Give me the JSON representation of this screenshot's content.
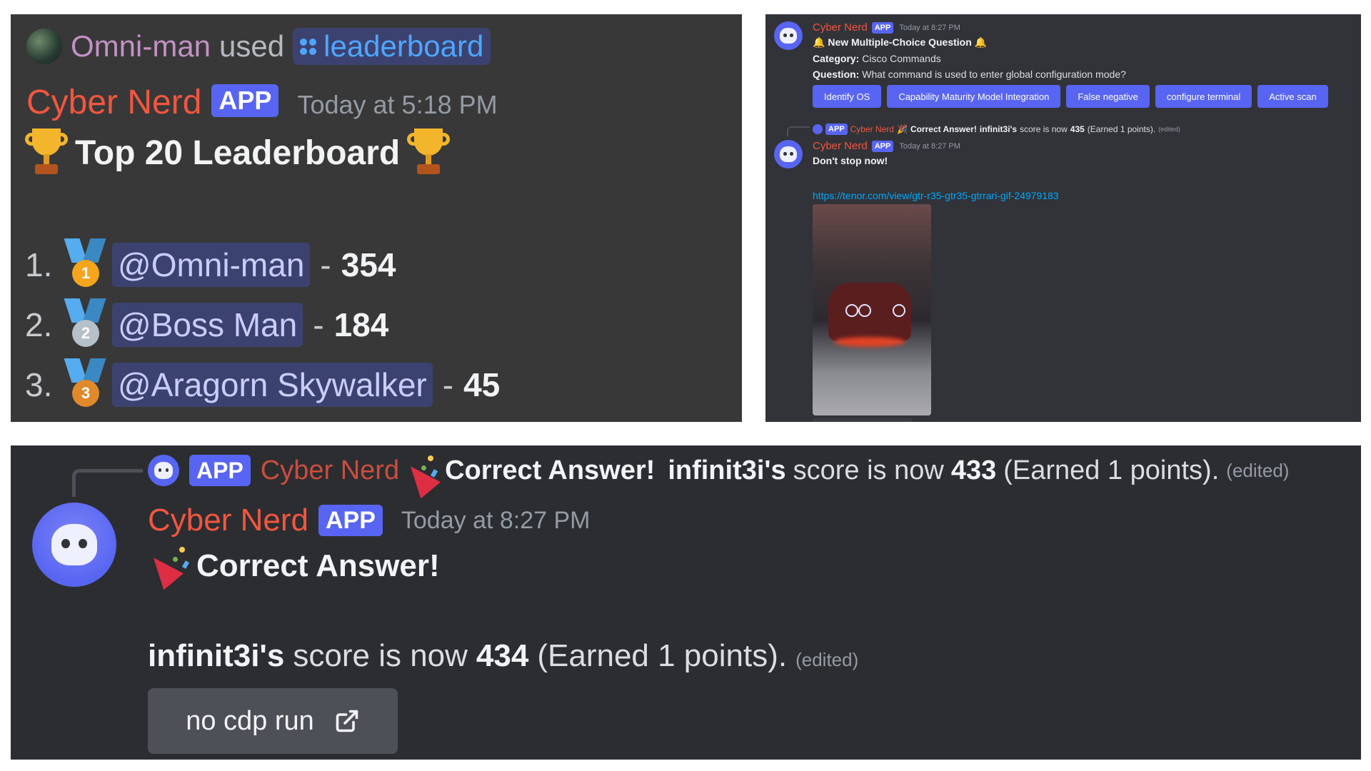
{
  "leaderboard_panel": {
    "invoker": "Omni-man",
    "used_text": "used",
    "command": "leaderboard",
    "bot_name": "Cyber Nerd",
    "app_tag": "APP",
    "timestamp": "Today at 5:18 PM",
    "title": "Top 20 Leaderboard",
    "entries": [
      {
        "rank": "1.",
        "medal": "1",
        "name": "@Omni-man",
        "score": "354",
        "medal_color": "#f4a51c"
      },
      {
        "rank": "2.",
        "medal": "2",
        "name": "@Boss Man",
        "score": "184",
        "medal_color": "#b6c0c9"
      },
      {
        "rank": "3.",
        "medal": "3",
        "name": "@Aragorn Skywalker",
        "score": "45",
        "medal_color": "#e08a2c"
      }
    ]
  },
  "question_panel": {
    "bot_name": "Cyber Nerd",
    "app_tag": "APP",
    "timestamp": "Today at 8:27 PM",
    "heading": "New Multiple-Choice Question",
    "category_label": "Category:",
    "category_value": "Cisco Commands",
    "question_label": "Question:",
    "question_value": "What command is used to enter global configuration mode?",
    "choices": [
      "Identify OS",
      "Capability Maturity Model Integration",
      "False negative",
      "configure terminal",
      "Active scan"
    ],
    "reply": {
      "bot_name": "Cyber Nerd",
      "heading": "Correct Answer!",
      "user": "infinit3i's",
      "text": "score is now",
      "score": "435",
      "earned": "(Earned 1 points).",
      "edited": "(edited)"
    },
    "followup": {
      "bot_name": "Cyber Nerd",
      "app_tag": "APP",
      "timestamp": "Today at 8:27 PM",
      "message": "Don't stop now!",
      "link": "https://tenor.com/view/gtr-r35-gtr35-gtrrari-gif-24979183"
    }
  },
  "answer_panel": {
    "reply": {
      "app_tag": "APP",
      "bot_name": "Cyber Nerd",
      "heading": "Correct Answer!",
      "user": "infinit3i's",
      "text": "score is now",
      "score": "433",
      "earned": "(Earned 1 points).",
      "edited": "(edited)"
    },
    "bot_name": "Cyber Nerd",
    "app_tag": "APP",
    "timestamp": "Today at 8:27 PM",
    "heading": "Correct Answer!",
    "user": "infinit3i's",
    "text": "score is now",
    "score": "434",
    "earned": "(Earned 1 points).",
    "edited": "(edited)",
    "button_label": "no cdp run"
  },
  "colors": {
    "bot_name": "#f2563f",
    "app_tag": "#5865f2",
    "mention_bg": "#3c4270",
    "choice_button": "#5865f2",
    "link": "#00a8fc"
  }
}
